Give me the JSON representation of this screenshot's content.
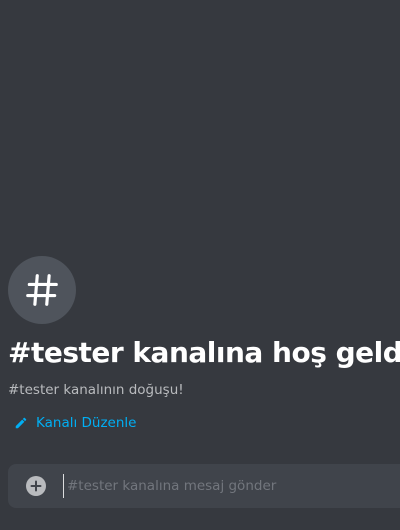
{
  "channel": {
    "welcome_title": "#tester kanalına hoş geldin!",
    "welcome_subtitle": "#tester kanalının doğuşu!",
    "edit_link_label": "Kanalı Düzenle"
  },
  "composer": {
    "placeholder": "#tester kanalına mesaj gönder"
  },
  "icons": {
    "channel": "hashtag-icon",
    "edit": "pencil-icon",
    "attach": "plus-circle-icon"
  },
  "colors": {
    "background": "#36393f",
    "icon_circle": "#4f545c",
    "link": "#00aff4",
    "composer": "#40444b",
    "muted_text": "#b9bbbe",
    "placeholder": "#72767d"
  }
}
